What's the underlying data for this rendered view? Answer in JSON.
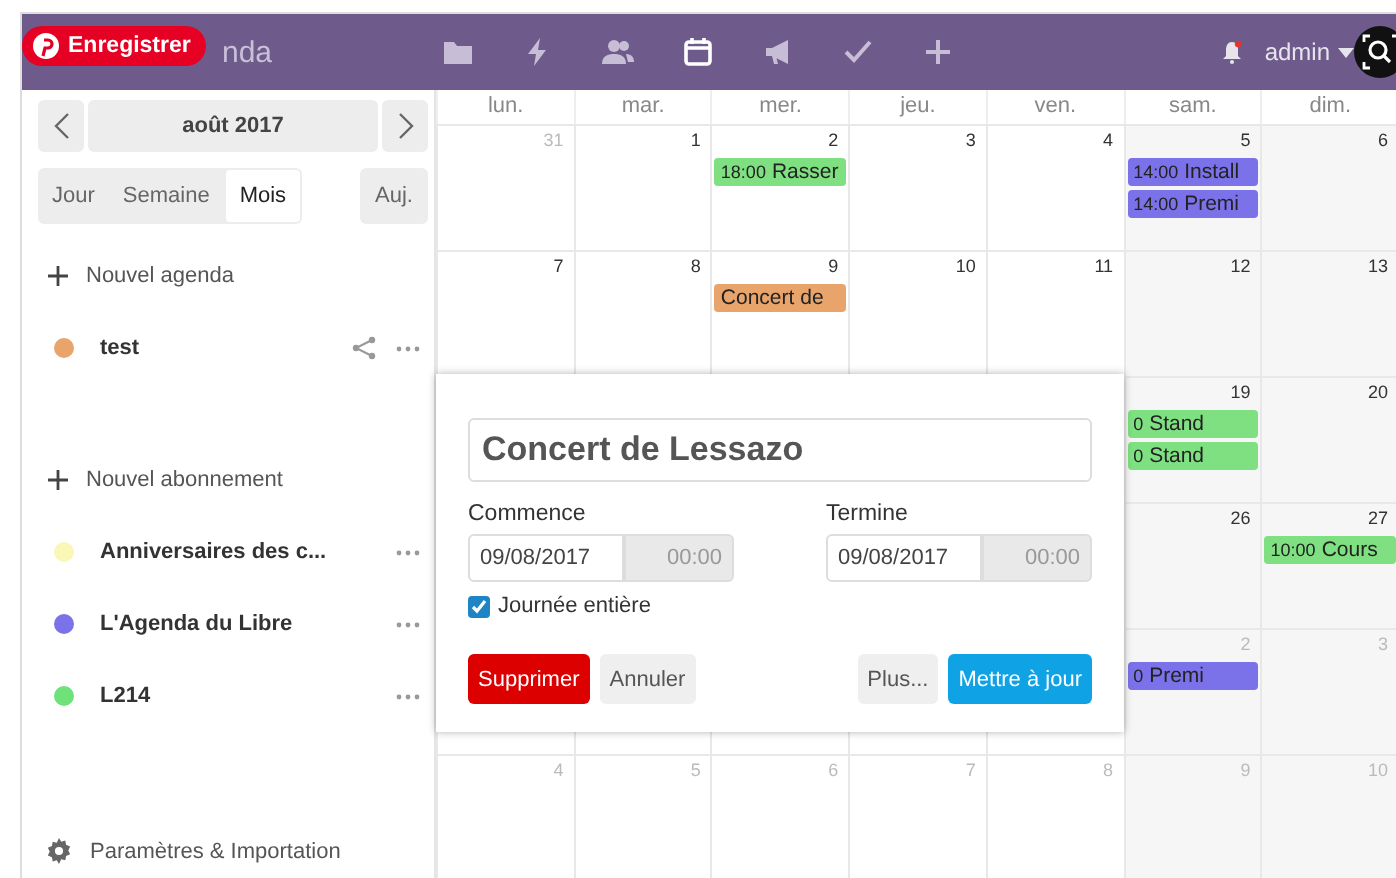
{
  "overlay_badge": {
    "label": "Enregistrer"
  },
  "header": {
    "app_name": "nda",
    "apps": [
      {
        "selected": false
      },
      {
        "selected": false
      },
      {
        "selected": false
      },
      {
        "selected": true
      },
      {
        "selected": false
      },
      {
        "selected": false
      },
      {
        "selected": false
      }
    ],
    "user": "admin"
  },
  "sidebar": {
    "month": "août 2017",
    "views": [
      {
        "label": "Jour",
        "selected": false
      },
      {
        "label": "Semaine",
        "selected": false
      },
      {
        "label": "Mois",
        "selected": true
      }
    ],
    "today": "Auj.",
    "new_calendar": "Nouvel agenda",
    "calendars": [
      {
        "name": "test",
        "color": "#e8a46a",
        "shared": true
      }
    ],
    "new_subscription": "Nouvel abonnement",
    "subscriptions": [
      {
        "name": "Anniversaires des c...",
        "color": "#fbf7b9"
      },
      {
        "name": "L'Agenda du Libre",
        "color": "#7b72e9"
      },
      {
        "name": "L214",
        "color": "#6ee17a"
      }
    ],
    "settings": "Paramètres & Importation"
  },
  "calendar": {
    "weekdays": [
      "lun.",
      "mar.",
      "mer.",
      "jeu.",
      "ven.",
      "sam.",
      "dim."
    ],
    "weeks": [
      {
        "days": [
          {
            "date": "31",
            "other_month": true
          },
          {
            "date": "1"
          },
          {
            "date": "2",
            "events": [
              {
                "time": "18:00",
                "title": "Rasser",
                "color": "#7ee081"
              }
            ]
          },
          {
            "date": "3"
          },
          {
            "date": "4"
          },
          {
            "date": "5",
            "events": [
              {
                "time": "14:00",
                "title": "Install",
                "color": "#7b72e9"
              },
              {
                "time": "14:00",
                "title": "Premi",
                "color": "#7b72e9"
              }
            ]
          },
          {
            "date": "6"
          }
        ]
      },
      {
        "days": [
          {
            "date": "7"
          },
          {
            "date": "8"
          },
          {
            "date": "9",
            "events": [
              {
                "title": "Concert de",
                "color": "#e8a46a"
              }
            ]
          },
          {
            "date": "10"
          },
          {
            "date": "11"
          },
          {
            "date": "12"
          },
          {
            "date": "13"
          }
        ]
      },
      {
        "days": [
          {
            "date": "19",
            "events": [
              {
                "time": "0",
                "title": "Stand",
                "color": "#7ee081"
              },
              {
                "time": "0",
                "title": "Stand",
                "color": "#7ee081"
              }
            ]
          },
          {
            "date": "20"
          }
        ]
      },
      {
        "days": [
          {
            "date": "26"
          },
          {
            "date": "27",
            "events": [
              {
                "time": "10:00",
                "title": "Cours",
                "color": "#7ee081"
              }
            ]
          }
        ]
      },
      {
        "days": [
          {
            "date": "2",
            "other_month": true,
            "events": [
              {
                "time": "0",
                "title": "Premi",
                "color": "#7b72e9"
              }
            ]
          },
          {
            "date": "3",
            "other_month": true
          }
        ]
      },
      {
        "days": [
          {
            "date": "4",
            "other_month": true
          },
          {
            "date": "5",
            "other_month": true
          },
          {
            "date": "6",
            "other_month": true
          },
          {
            "date": "7",
            "other_month": true
          },
          {
            "date": "8",
            "other_month": true
          },
          {
            "date": "9",
            "other_month": true
          },
          {
            "date": "10",
            "other_month": true
          }
        ]
      }
    ]
  },
  "popup": {
    "title": "Concert de Lessazo",
    "start": {
      "label": "Commence",
      "date": "09/08/2017",
      "time": "00:00"
    },
    "end": {
      "label": "Termine",
      "date": "09/08/2017",
      "time": "00:00"
    },
    "all_day": {
      "label": "Journée entière",
      "checked": true
    },
    "buttons_left": [
      {
        "label": "Supprimer",
        "kind": "danger"
      },
      {
        "label": "Annuler",
        "kind": "default"
      }
    ],
    "buttons_right": [
      {
        "label": "Plus...",
        "kind": "default"
      },
      {
        "label": "Mettre à jour",
        "kind": "primary"
      }
    ]
  }
}
